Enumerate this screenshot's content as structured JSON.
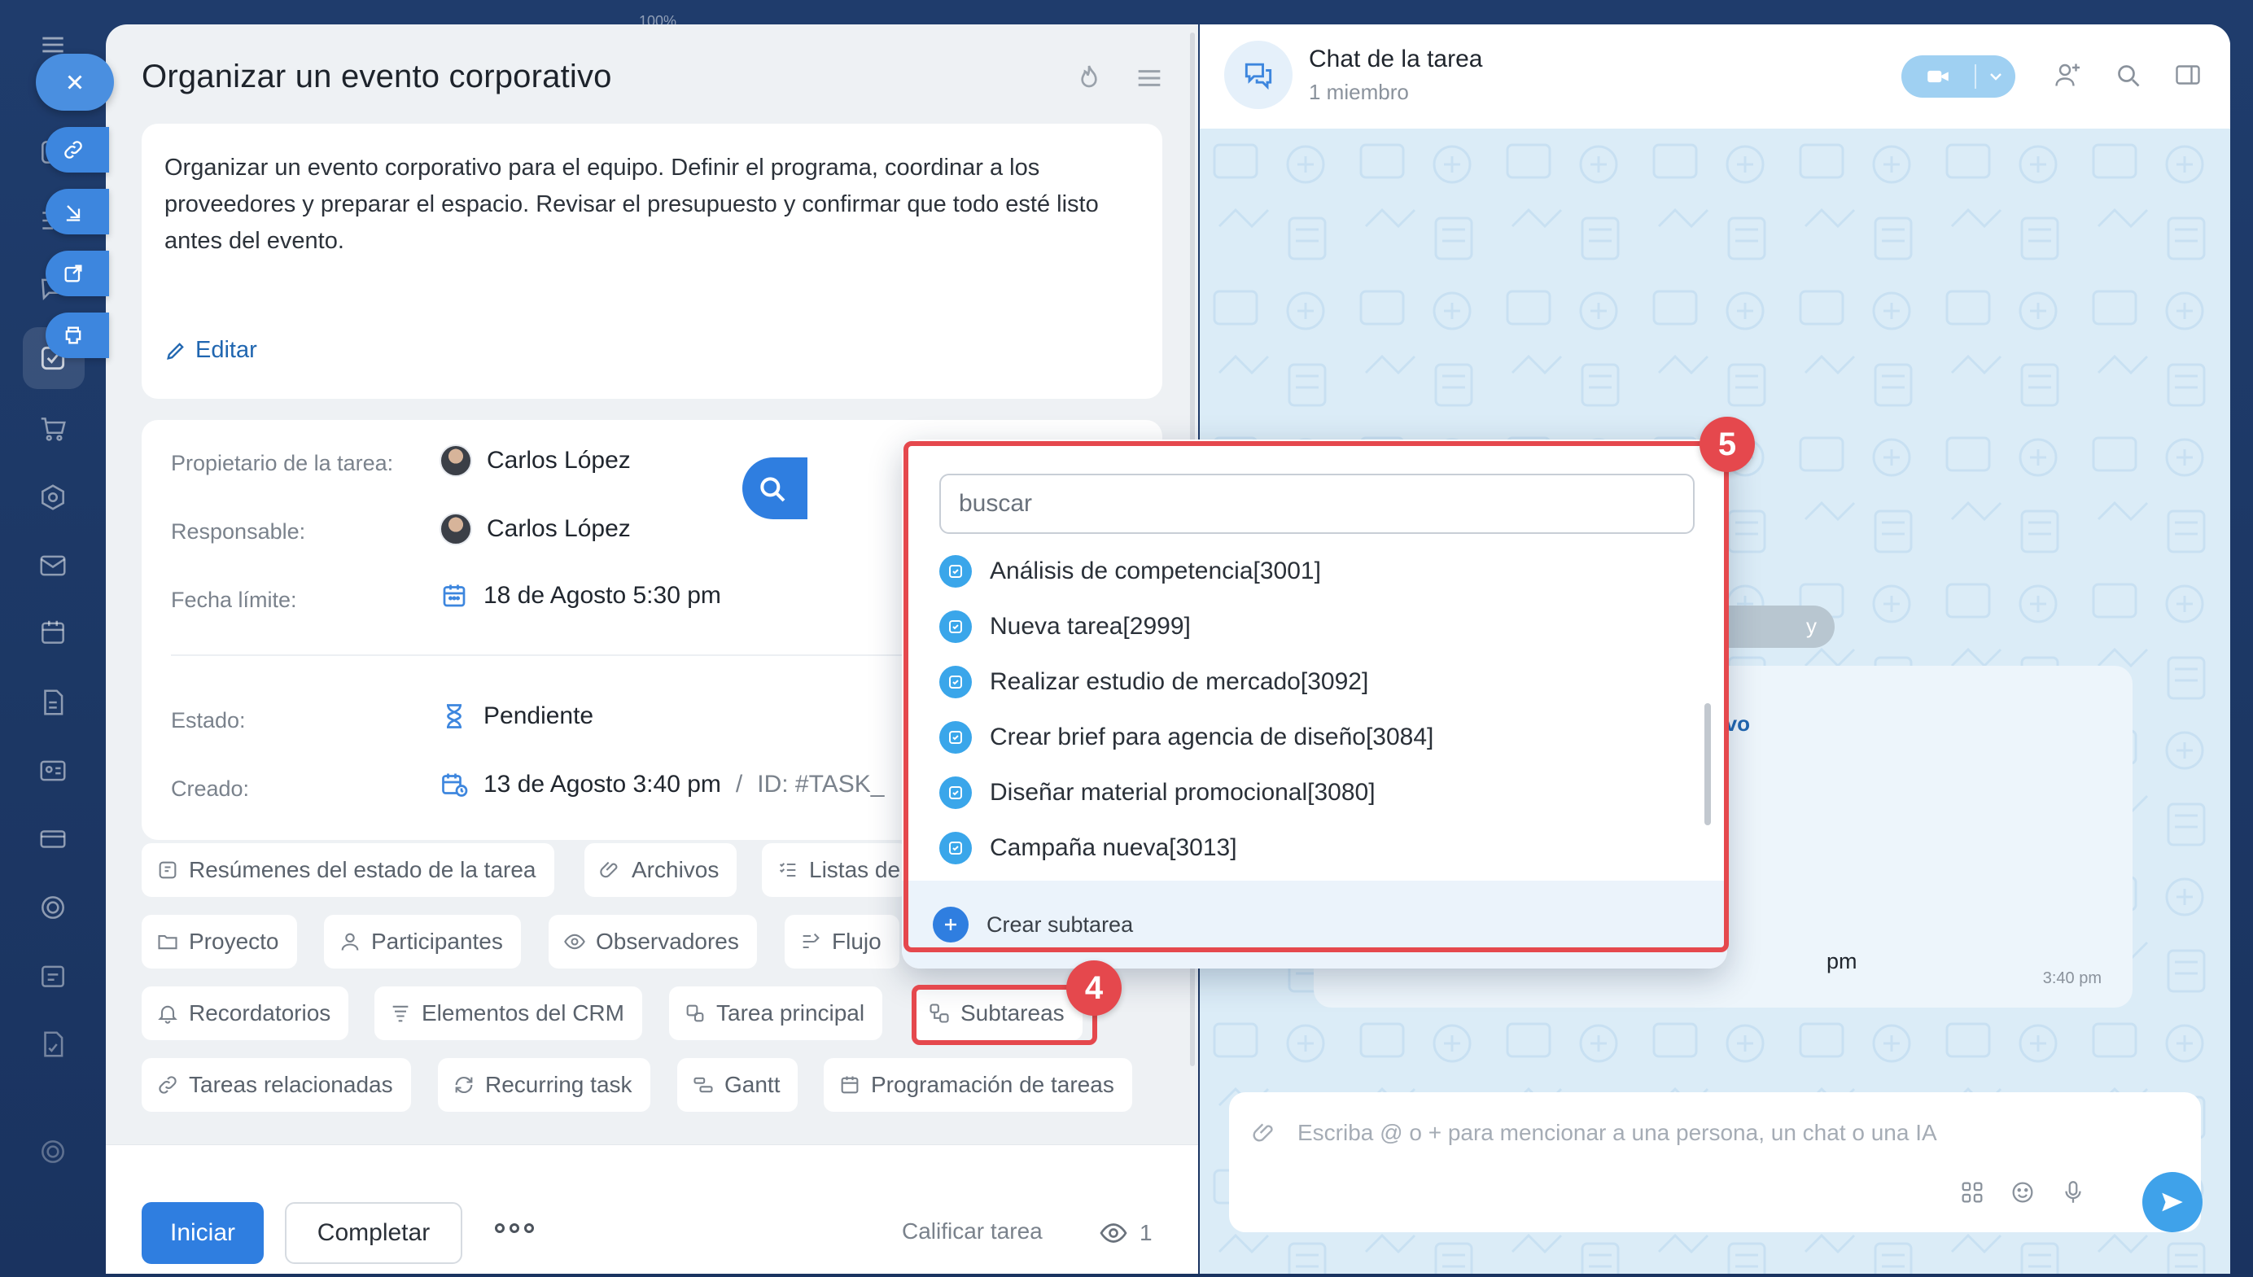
{
  "zoom": "100%",
  "task": {
    "title": "Organizar un evento corporativo",
    "description": "Organizar un evento corporativo para el equipo. Definir el programa, coordinar a los proveedores y preparar el espacio. Revisar el presupuesto y confirmar que todo esté listo antes del evento.",
    "edit_label": "Editar",
    "details": {
      "owner_label": "Propietario de la tarea:",
      "owner_name": "Carlos López",
      "responsible_label": "Responsable:",
      "responsible_name": "Carlos López",
      "deadline_label": "Fecha límite:",
      "deadline_value": "18 de Agosto 5:30 pm",
      "status_label": "Estado:",
      "status_value": "Pendiente",
      "created_label": "Creado:",
      "created_value": "13 de Agosto 3:40 pm",
      "created_sep": "/",
      "id_text": "ID: #TASK_"
    },
    "chips": [
      {
        "label": "Resúmenes del estado de la tarea",
        "icon": "summary-icon"
      },
      {
        "label": "Archivos",
        "icon": "paperclip-icon"
      },
      {
        "label": "Listas de",
        "icon": "checklist-icon"
      },
      {
        "label": "Proyecto",
        "icon": "folder-icon"
      },
      {
        "label": "Participantes",
        "icon": "person-icon"
      },
      {
        "label": "Observadores",
        "icon": "eye-icon"
      },
      {
        "label": "Flujo",
        "icon": "flow-icon"
      },
      {
        "label": "Recordatorios",
        "icon": "bell-icon"
      },
      {
        "label": "Elementos del CRM",
        "icon": "crm-icon"
      },
      {
        "label": "Tarea principal",
        "icon": "parent-task-icon"
      },
      {
        "label": "Subtareas",
        "icon": "subtasks-icon"
      },
      {
        "label": "Tareas relacionadas",
        "icon": "link-icon"
      },
      {
        "label": "Recurring task",
        "icon": "recurring-icon"
      },
      {
        "label": "Gantt",
        "icon": "gantt-icon"
      },
      {
        "label": "Programación de tareas",
        "icon": "calendar-icon"
      }
    ],
    "footer": {
      "start_label": "Iniciar",
      "complete_label": "Completar",
      "rate_label": "Calificar tarea",
      "views_count": "1"
    }
  },
  "popup": {
    "search_placeholder": "buscar",
    "items": [
      "Análisis de competencia[3001]",
      "Nueva tarea[2999]",
      "Realizar estudio de mercado[3092]",
      "Crear brief para agencia de diseño[3084]",
      "Diseñar material promocional[3080]",
      "Campaña nueva[3013]"
    ],
    "create_label": "Crear subtarea"
  },
  "chat": {
    "title": "Chat de la tarea",
    "subtitle": "1 miembro",
    "date_fragment": "y",
    "message_link_fragment": "tivo",
    "message_fragment": "pm",
    "message_time": "3:40 pm",
    "composer_placeholder": "Escriba @ o + para mencionar a una persona, un chat o una IA"
  },
  "annotations": {
    "badge_4": "4",
    "badge_5": "5",
    "highlight_color": "#e5484d"
  },
  "colors": {
    "accent": "#2f7ee0",
    "link": "#2066b0",
    "background_nav": "#1f3c6c",
    "chat_bg": "#dbecf7"
  }
}
